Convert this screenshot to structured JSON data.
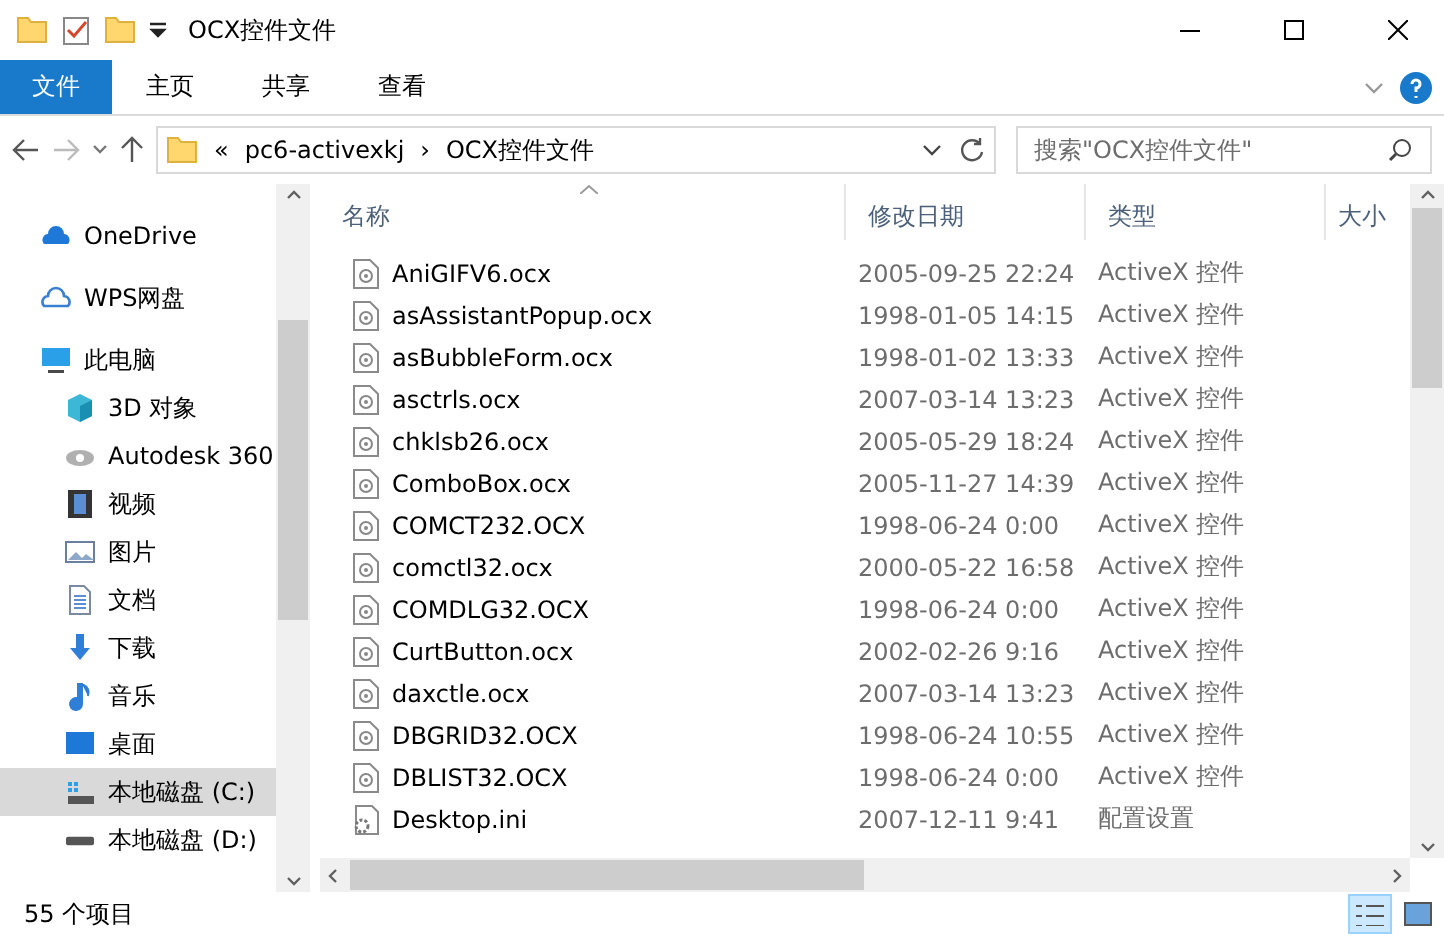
{
  "window": {
    "title": "OCX控件文件"
  },
  "ribbon": {
    "tabs": [
      {
        "label": "文件",
        "selected": true
      },
      {
        "label": "主页",
        "selected": false
      },
      {
        "label": "共享",
        "selected": false
      },
      {
        "label": "查看",
        "selected": false
      }
    ]
  },
  "address": {
    "overflow": "«",
    "path": [
      "pc6-activexkj",
      "OCX控件文件"
    ],
    "separator": "›",
    "search_placeholder": "搜索\"OCX控件文件\""
  },
  "sidebar": {
    "items": [
      {
        "label": "OneDrive",
        "kind": "cloud",
        "selected": false
      },
      {
        "label": "WPS网盘",
        "kind": "cloud-outline",
        "selected": false
      },
      {
        "label": "此电脑",
        "kind": "computer",
        "selected": false,
        "children": [
          {
            "label": "3D 对象",
            "kind": "cube",
            "selected": false
          },
          {
            "label": "Autodesk 360",
            "kind": "eye",
            "selected": false
          },
          {
            "label": "视频",
            "kind": "film",
            "selected": false
          },
          {
            "label": "图片",
            "kind": "image",
            "selected": false
          },
          {
            "label": "文档",
            "kind": "document",
            "selected": false
          },
          {
            "label": "下载",
            "kind": "download",
            "selected": false
          },
          {
            "label": "音乐",
            "kind": "music",
            "selected": false
          },
          {
            "label": "桌面",
            "kind": "desktop",
            "selected": false
          },
          {
            "label": "本地磁盘 (C:)",
            "kind": "drive-system",
            "selected": true
          },
          {
            "label": "本地磁盘 (D:)",
            "kind": "drive",
            "selected": false
          }
        ]
      }
    ]
  },
  "table": {
    "columns": [
      "名称",
      "修改日期",
      "类型",
      "大小"
    ],
    "rows": [
      {
        "name": "AniGIFV6.ocx",
        "date": "2005-09-25 22:24",
        "type": "ActiveX 控件",
        "kind": "ocx"
      },
      {
        "name": "asAssistantPopup.ocx",
        "date": "1998-01-05 14:15",
        "type": "ActiveX 控件",
        "kind": "ocx"
      },
      {
        "name": "asBubbleForm.ocx",
        "date": "1998-01-02 13:33",
        "type": "ActiveX 控件",
        "kind": "ocx"
      },
      {
        "name": "asctrls.ocx",
        "date": "2007-03-14 13:23",
        "type": "ActiveX 控件",
        "kind": "ocx"
      },
      {
        "name": "chklsb26.ocx",
        "date": "2005-05-29 18:24",
        "type": "ActiveX 控件",
        "kind": "ocx"
      },
      {
        "name": "ComboBox.ocx",
        "date": "2005-11-27 14:39",
        "type": "ActiveX 控件",
        "kind": "ocx"
      },
      {
        "name": "COMCT232.OCX",
        "date": "1998-06-24 0:00",
        "type": "ActiveX 控件",
        "kind": "ocx"
      },
      {
        "name": "comctl32.ocx",
        "date": "2000-05-22 16:58",
        "type": "ActiveX 控件",
        "kind": "ocx"
      },
      {
        "name": "COMDLG32.OCX",
        "date": "1998-06-24 0:00",
        "type": "ActiveX 控件",
        "kind": "ocx"
      },
      {
        "name": "CurtButton.ocx",
        "date": "2002-02-26 9:16",
        "type": "ActiveX 控件",
        "kind": "ocx"
      },
      {
        "name": "daxctle.ocx",
        "date": "2007-03-14 13:23",
        "type": "ActiveX 控件",
        "kind": "ocx"
      },
      {
        "name": "DBGRID32.OCX",
        "date": "1998-06-24 10:55",
        "type": "ActiveX 控件",
        "kind": "ocx"
      },
      {
        "name": "DBLIST32.OCX",
        "date": "1998-06-24 0:00",
        "type": "ActiveX 控件",
        "kind": "ocx"
      },
      {
        "name": "Desktop.ini",
        "date": "2007-12-11 9:41",
        "type": "配置设置",
        "kind": "ini"
      }
    ]
  },
  "status_bar": {
    "count": "55 个项目",
    "views": [
      {
        "kind": "details",
        "selected": true
      },
      {
        "kind": "thumbnails",
        "selected": false
      }
    ]
  }
}
